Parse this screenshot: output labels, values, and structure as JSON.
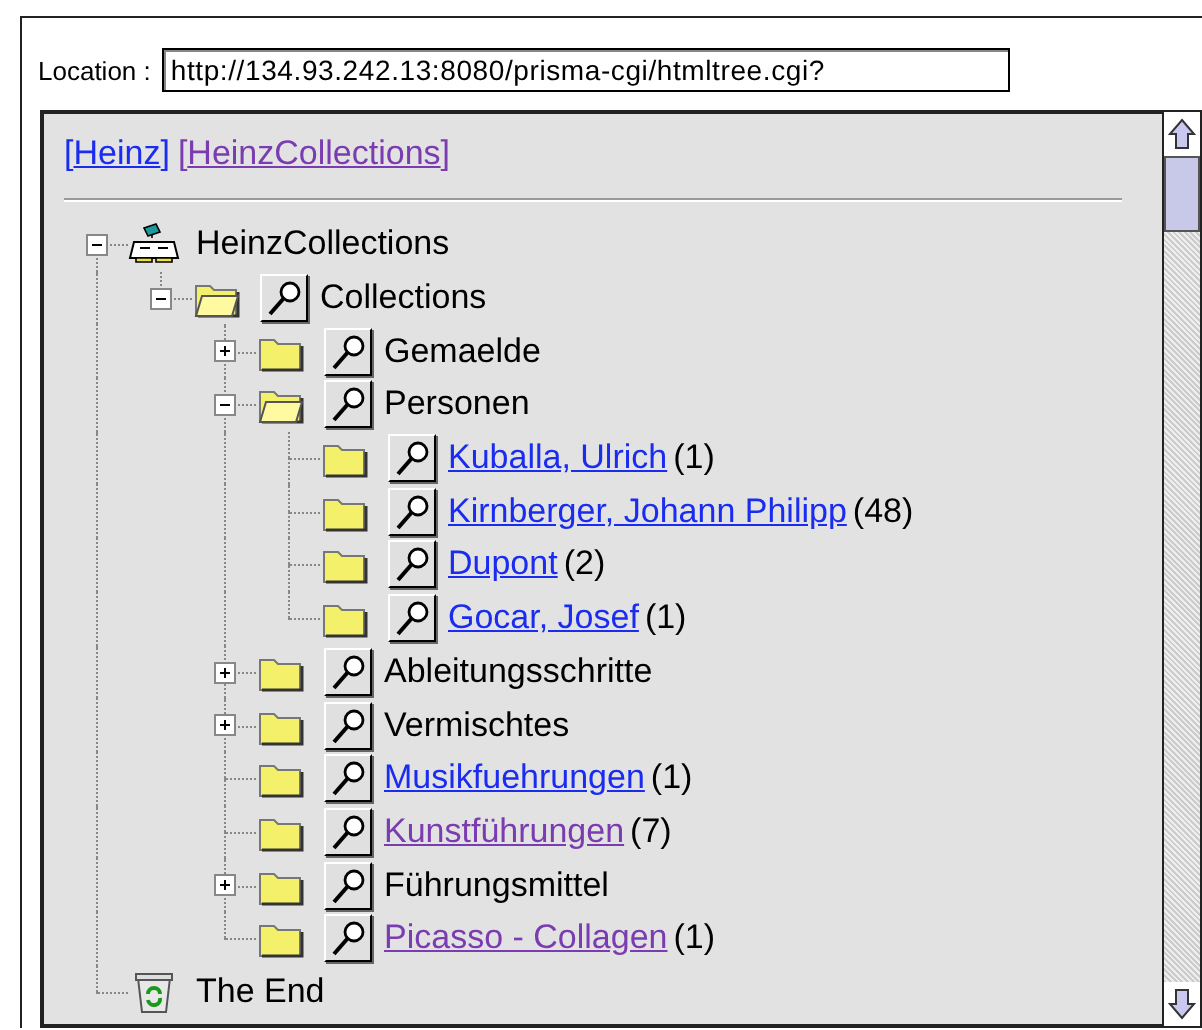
{
  "location": {
    "label": "Location :",
    "value": "http://134.93.242.13:8080/prisma-cgi/htmltree.cgi?"
  },
  "breadcrumbs": [
    {
      "open": "[",
      "label": "Heinz",
      "close": "]",
      "visited": false
    },
    {
      "open": "[",
      "label": "HeinzCollections",
      "close": "]",
      "visited": true
    }
  ],
  "tree": [
    {
      "kind": "root",
      "label": "HeinzCollections",
      "link": false,
      "expandable": true,
      "expanded": true,
      "children": [
        {
          "kind": "folder",
          "label": "Collections",
          "link": false,
          "expandable": true,
          "expanded": true,
          "children": [
            {
              "kind": "folder",
              "label": "Gemaelde",
              "link": false,
              "expandable": true,
              "expanded": false
            },
            {
              "kind": "folder",
              "label": "Personen",
              "link": false,
              "expandable": true,
              "expanded": true,
              "children": [
                {
                  "kind": "folder",
                  "label": "Kuballa, Ulrich",
                  "count": "(1)",
                  "link": true,
                  "visited": false,
                  "expandable": false,
                  "expanded": false
                },
                {
                  "kind": "folder",
                  "label": "Kirnberger, Johann Philipp",
                  "count": "(48)",
                  "link": true,
                  "visited": false,
                  "expandable": false,
                  "expanded": false
                },
                {
                  "kind": "folder",
                  "label": "Dupont",
                  "count": "(2)",
                  "link": true,
                  "visited": false,
                  "expandable": false,
                  "expanded": false
                },
                {
                  "kind": "folder",
                  "label": "Gocar, Josef",
                  "count": "(1)",
                  "link": true,
                  "visited": false,
                  "expandable": false,
                  "expanded": false
                }
              ]
            },
            {
              "kind": "folder",
              "label": "Ableitungsschritte",
              "link": false,
              "expandable": true,
              "expanded": false
            },
            {
              "kind": "folder",
              "label": "Vermischtes",
              "link": false,
              "expandable": true,
              "expanded": false
            },
            {
              "kind": "folder",
              "label": "Musikfuehrungen",
              "count": "(1)",
              "link": true,
              "visited": false,
              "expandable": false,
              "expanded": false
            },
            {
              "kind": "folder",
              "label": "Kunstführungen",
              "count": "(7)",
              "link": true,
              "visited": true,
              "expandable": false,
              "expanded": false
            },
            {
              "kind": "folder",
              "label": "Führungsmittel",
              "link": false,
              "expandable": true,
              "expanded": false
            },
            {
              "kind": "folder",
              "label": "Picasso - Collagen",
              "count": "(1)",
              "link": true,
              "visited": true,
              "expandable": false,
              "expanded": false
            }
          ]
        }
      ]
    },
    {
      "kind": "end",
      "label": "The End",
      "link": false
    }
  ]
}
